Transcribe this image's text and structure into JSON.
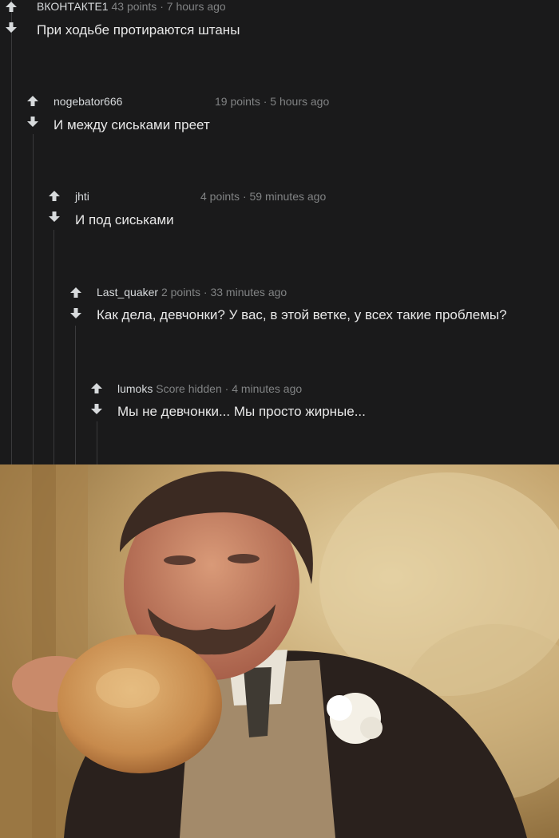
{
  "comments": [
    {
      "user": "ВКОНТАКТЕ1",
      "score": "43 points",
      "sep": "·",
      "time": "7 hours ago",
      "text": "При ходьбе протираются штаны"
    },
    {
      "user": "nogebator666",
      "score": "19 points",
      "sep": "·",
      "time": "5 hours ago",
      "text": "И между сиськами преет"
    },
    {
      "user": "jhti",
      "score": "4 points",
      "sep": "·",
      "time": "59 minutes ago",
      "text": "И под сиськами"
    },
    {
      "user": "Last_quaker",
      "score": "2 points",
      "sep": "·",
      "time": "33 minutes ago",
      "text": "Как дела, девчонки? У вас, в этой ветке, у всех такие проблемы?"
    },
    {
      "user": "lumoks",
      "score": "Score hidden",
      "sep": "·",
      "time": "4 minutes ago",
      "text": "Мы не девчонки... Мы просто жирные..."
    }
  ],
  "icons": {
    "upvote": "upvote-arrow-icon",
    "downvote": "downvote-arrow-icon"
  },
  "colors": {
    "background": "#1a1a1b",
    "username": "#d7dadc",
    "meta": "#818384",
    "text": "#e8e8e8",
    "rail": "#3a3a3c"
  }
}
